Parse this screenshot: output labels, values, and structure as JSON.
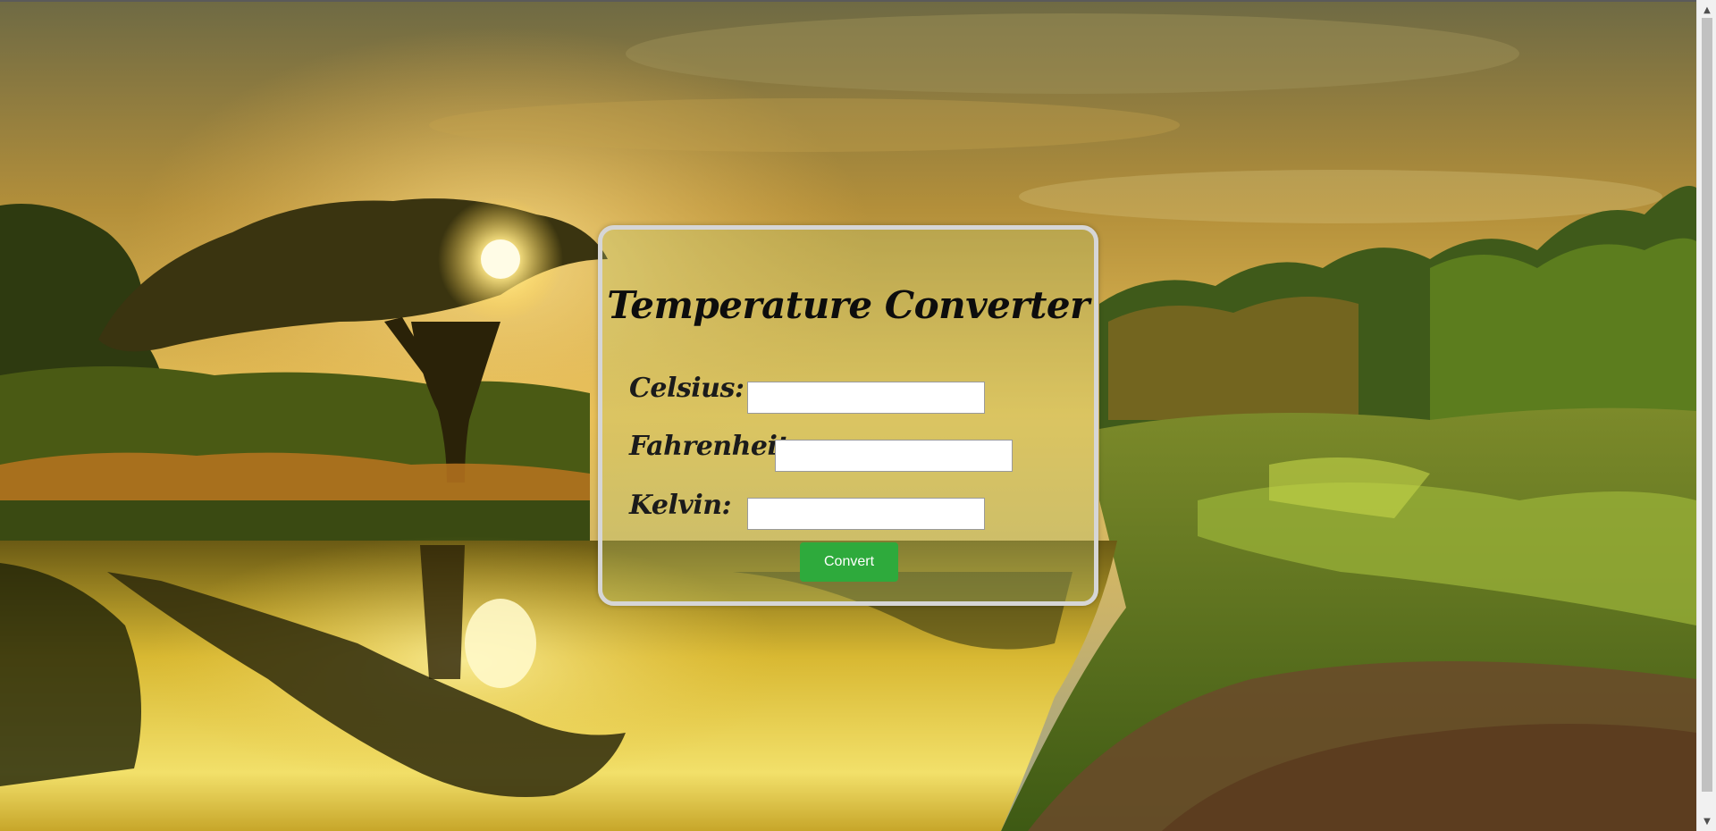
{
  "app": {
    "title": "Temperature Converter"
  },
  "background": {
    "icon": "sunset-lake-landscape-image"
  },
  "form": {
    "celsius": {
      "label": "Celsius:",
      "value": "",
      "placeholder": ""
    },
    "fahrenheit": {
      "label": "Fahrenheit:",
      "value": "",
      "placeholder": ""
    },
    "kelvin": {
      "label": "Kelvin:",
      "value": "",
      "placeholder": ""
    },
    "convert_label": "Convert"
  },
  "scrollbar": {
    "up_icon": "▲",
    "down_icon": "▼"
  },
  "colors": {
    "button": "#2eaa3c",
    "card_border": "#d6d6d6"
  }
}
